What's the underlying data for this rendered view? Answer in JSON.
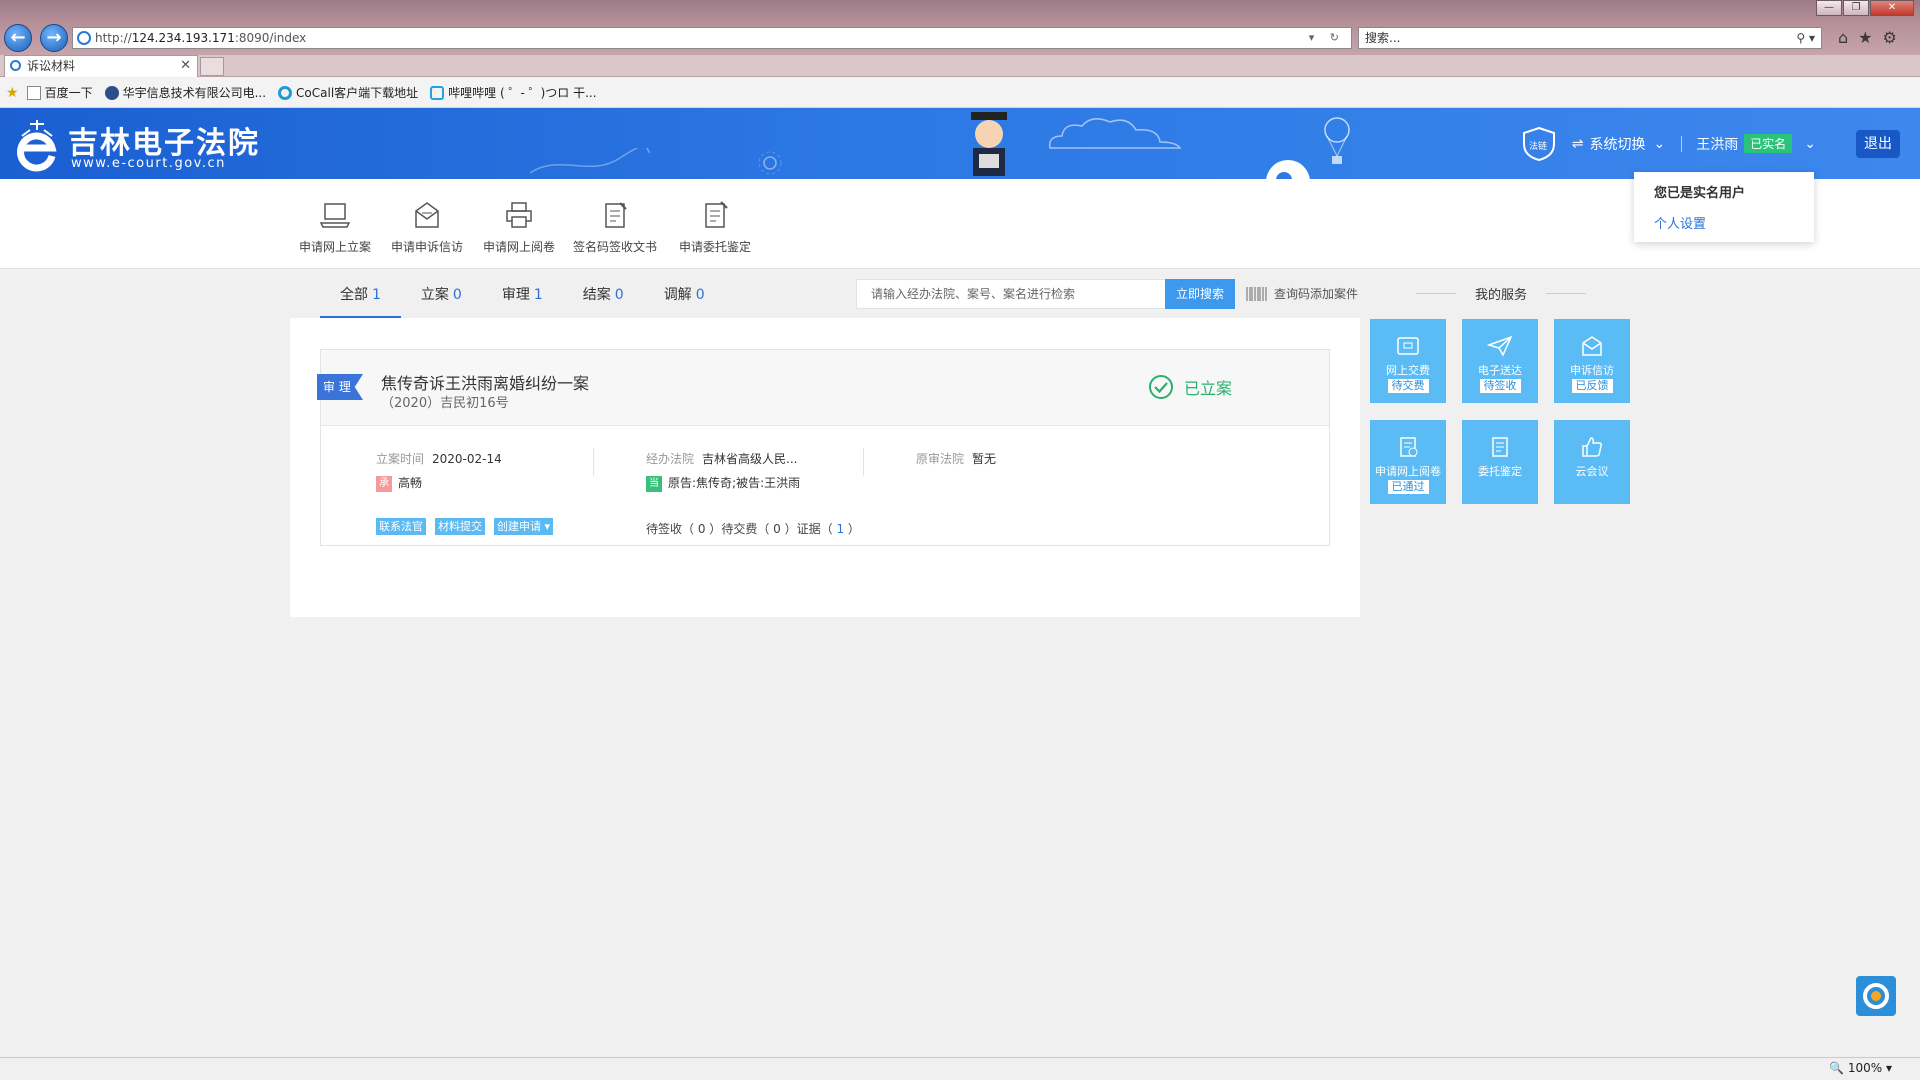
{
  "browser": {
    "url_prefix": "http://",
    "url_host": "124.234.193.171",
    "url_path": ":8090/index",
    "search_placeholder": "搜索...",
    "tab_title": "诉讼材料",
    "favorites": [
      "百度一下",
      "华宇信息技术有限公司电...",
      "CoCall客户端下载地址",
      "哔哩哔哩 ( ゜- ゜)つロ 干..."
    ],
    "zoom": "100%"
  },
  "header": {
    "site_name": "吉林电子法院",
    "site_url": "www.e-court.gov.cn",
    "chain_label": "法链",
    "system_switch": "系统切换",
    "user_name": "王洪雨",
    "verified_badge": "已实名",
    "logout": "退出"
  },
  "user_menu": {
    "title": "您已是实名用户",
    "settings": "个人设置"
  },
  "top_menu": [
    {
      "label": "申请网上立案",
      "icon": "laptop-icon"
    },
    {
      "label": "申请申诉信访",
      "icon": "envelope-icon"
    },
    {
      "label": "申请网上阅卷",
      "icon": "printer-icon"
    },
    {
      "label": "签名码签收文书",
      "icon": "sign-doc-icon"
    },
    {
      "label": "申请委托鉴定",
      "icon": "appraisal-icon"
    }
  ],
  "filters": [
    {
      "label": "全部",
      "count": "1"
    },
    {
      "label": "立案",
      "count": "0"
    },
    {
      "label": "审理",
      "count": "1"
    },
    {
      "label": "结案",
      "count": "0"
    },
    {
      "label": "调解",
      "count": "0"
    }
  ],
  "case_search": {
    "placeholder": "请输入经办法院、案号、案名进行检索",
    "button": "立即搜索",
    "add_by_code": "查询码添加案件"
  },
  "case": {
    "stage": "审 理",
    "title": "焦传奇诉王洪雨离婚纠纷一案",
    "case_no": "（2020）吉民初16号",
    "status": "已立案",
    "filing_time_label": "立案时间",
    "filing_time": "2020-02-14",
    "judge_tag": "承",
    "judge": "高畅",
    "court_label": "经办法院",
    "court": "吉林省高级人民...",
    "party_tag": "当",
    "parties": "原告:焦传奇;被告:王洪雨",
    "orig_court_label": "原审法院",
    "orig_court": "暂无",
    "actions": [
      "联系法官",
      "材料提交",
      "创建申请"
    ],
    "count_sign_label": "待签收",
    "count_sign": "0",
    "count_fee_label": "待交费",
    "count_fee": "0",
    "count_evidence_label": "证据",
    "count_evidence": "1"
  },
  "services": {
    "title": "我的服务",
    "items": [
      {
        "label": "网上交费",
        "badge": "待交费",
        "icon": "wallet-icon"
      },
      {
        "label": "电子送达",
        "badge": "待签收",
        "icon": "paper-plane-icon"
      },
      {
        "label": "申诉信访",
        "badge": "已反馈",
        "icon": "mail-icon"
      },
      {
        "label": "申请网上阅卷",
        "badge": "已通过",
        "icon": "doc-check-icon"
      },
      {
        "label": "委托鉴定",
        "badge": "",
        "icon": "doc-edit-icon"
      },
      {
        "label": "云会议",
        "badge": "",
        "icon": "thumbs-up-icon"
      }
    ]
  },
  "colors": {
    "brand_blue": "#2c78e4",
    "service_tile": "#5bbcf5",
    "status_green": "#2ab06d",
    "verified_green": "#2ac37a"
  }
}
